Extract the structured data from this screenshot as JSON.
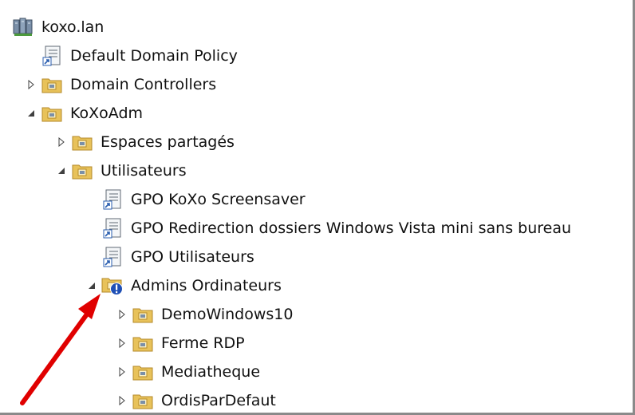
{
  "tree": {
    "root": {
      "label": "koxo.lan",
      "icon": "domain-icon"
    },
    "items": [
      {
        "label": "Default Domain Policy",
        "icon": "gpo-link-icon",
        "expander": "none"
      },
      {
        "label": "Domain Controllers",
        "icon": "ou-folder-icon",
        "expander": "collapsed"
      },
      {
        "label": "KoXoAdm",
        "icon": "ou-folder-icon",
        "expander": "expanded"
      },
      {
        "label": "Espaces partagés",
        "icon": "ou-folder-icon",
        "expander": "collapsed"
      },
      {
        "label": "Utilisateurs",
        "icon": "ou-folder-icon",
        "expander": "expanded"
      },
      {
        "label": "GPO KoXo Screensaver",
        "icon": "gpo-link-icon",
        "expander": "none"
      },
      {
        "label": "GPO Redirection dossiers Windows Vista mini sans bureau",
        "icon": "gpo-link-icon",
        "expander": "none"
      },
      {
        "label": "GPO Utilisateurs",
        "icon": "gpo-link-icon",
        "expander": "none"
      },
      {
        "label": "Admins Ordinateurs",
        "icon": "ou-folder-warning-icon",
        "expander": "expanded"
      },
      {
        "label": "DemoWindows10",
        "icon": "ou-folder-icon",
        "expander": "collapsed"
      },
      {
        "label": "Ferme RDP",
        "icon": "ou-folder-icon",
        "expander": "collapsed"
      },
      {
        "label": "Mediatheque",
        "icon": "ou-folder-icon",
        "expander": "collapsed"
      },
      {
        "label": "OrdisParDefaut",
        "icon": "ou-folder-icon",
        "expander": "collapsed"
      }
    ]
  },
  "annotation": {
    "icon": "red-arrow-icon",
    "color": "#e00000"
  },
  "colors": {
    "folder": "#e8c25a",
    "folder_dark": "#b48a2a",
    "warning": "#1f4fb5",
    "border": "#8a8a8a"
  }
}
